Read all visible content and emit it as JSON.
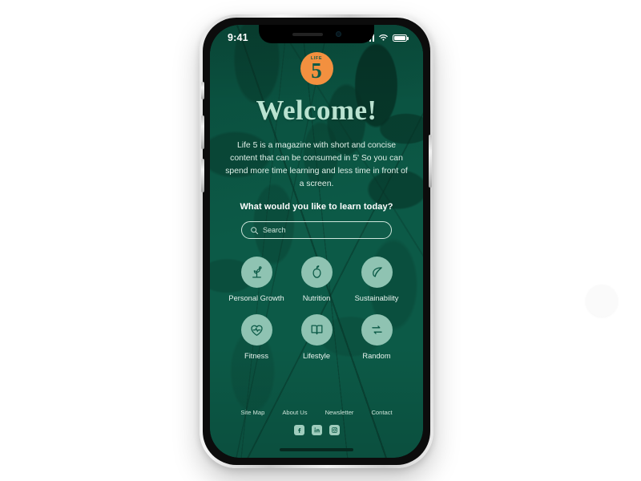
{
  "canvas": {
    "background_color": "#ffffff",
    "decorative_circle_color": "#fafafa"
  },
  "device": {
    "type": "smartphone-mockup",
    "frame_color": "#d8d8d8",
    "buttons": [
      "silent-switch",
      "volume-up",
      "volume-down",
      "power"
    ]
  },
  "status_bar": {
    "time": "9:41",
    "icons": [
      "signal-bars-icon",
      "wifi-icon",
      "battery-icon"
    ]
  },
  "screen": {
    "background_color": "#0c5a47",
    "accent_color": "#f3903f",
    "icon_circle_color": "#8fc3b2",
    "heading_color": "#b9e2d0"
  },
  "logo": {
    "name": "life-5-logo",
    "word": "LIFE",
    "number": "5",
    "color": "#f3903f"
  },
  "hero": {
    "title": "Welcome!",
    "paragraph": "Life 5 is a magazine with short and concise content that can be consumed in 5'\nSo you can spend more time learning and less time in front of a screen.",
    "subheading": "What would you like to learn today?"
  },
  "search": {
    "placeholder": "Search",
    "value": "",
    "icon": "search-icon"
  },
  "categories": [
    {
      "label": "Personal Growth",
      "icon": "sprout-icon"
    },
    {
      "label": "Nutrition",
      "icon": "apple-icon"
    },
    {
      "label": "Sustainability",
      "icon": "leaf-icon"
    },
    {
      "label": "Fitness",
      "icon": "heart-pulse-icon"
    },
    {
      "label": "Lifestyle",
      "icon": "book-icon"
    },
    {
      "label": "Random",
      "icon": "shuffle-icon"
    }
  ],
  "footer": {
    "links": [
      {
        "label": "Site Map"
      },
      {
        "label": "About Us"
      },
      {
        "label": "Newsletter"
      },
      {
        "label": "Contact"
      }
    ],
    "socials": [
      {
        "name": "facebook-icon"
      },
      {
        "name": "linkedin-icon"
      },
      {
        "name": "instagram-icon"
      }
    ]
  }
}
